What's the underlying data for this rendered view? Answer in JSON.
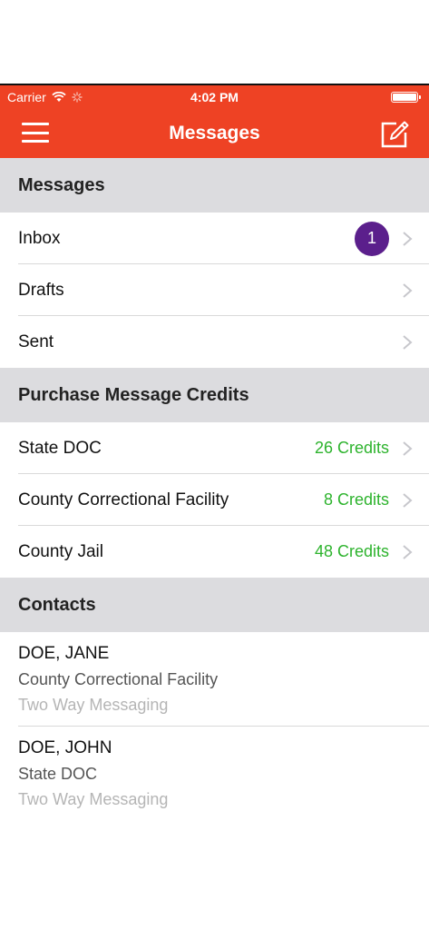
{
  "status": {
    "carrier": "Carrier",
    "time": "4:02 PM"
  },
  "nav": {
    "title": "Messages",
    "menu_icon": "hamburger-icon",
    "compose_icon": "compose-icon"
  },
  "colors": {
    "brand": "#ee4224",
    "badge": "#5b1f8c",
    "credits": "#2db32d"
  },
  "messages_section": {
    "header": "Messages",
    "items": [
      {
        "label": "Inbox",
        "badge": "1"
      },
      {
        "label": "Drafts"
      },
      {
        "label": "Sent"
      }
    ]
  },
  "credits_section": {
    "header": "Purchase Message Credits",
    "items": [
      {
        "label": "State DOC",
        "credits": "26 Credits"
      },
      {
        "label": "County Correctional Facility",
        "credits": "8 Credits"
      },
      {
        "label": "County Jail",
        "credits": "48 Credits"
      }
    ]
  },
  "contacts_section": {
    "header": "Contacts",
    "items": [
      {
        "name": "DOE, JANE",
        "facility": "County Correctional Facility",
        "type": "Two Way Messaging"
      },
      {
        "name": "DOE, JOHN",
        "facility": "State DOC",
        "type": "Two Way Messaging"
      }
    ]
  }
}
